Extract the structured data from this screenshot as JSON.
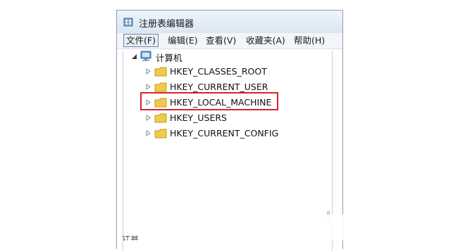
{
  "window": {
    "title": "注册表编辑器"
  },
  "menubar": {
    "items": [
      "文件(F)",
      "编辑(E)",
      "查看(V)",
      "收藏夹(A)",
      "帮助(H)"
    ],
    "active_index": 0
  },
  "tree": {
    "root": {
      "label": "计算机",
      "expanded": true
    },
    "children": [
      {
        "label": "HKEY_CLASSES_ROOT"
      },
      {
        "label": "HKEY_CURRENT_USER"
      },
      {
        "label": "HKEY_LOCAL_MACHINE",
        "highlighted": true
      },
      {
        "label": "HKEY_USERS"
      },
      {
        "label": "HKEY_CURRENT_CONFIG"
      }
    ]
  },
  "status_bar": {
    "text": "计算"
  },
  "colors": {
    "highlight_box": "#d6252a",
    "folder": "#f1c94f",
    "chrome_border": "#8c9db1"
  }
}
